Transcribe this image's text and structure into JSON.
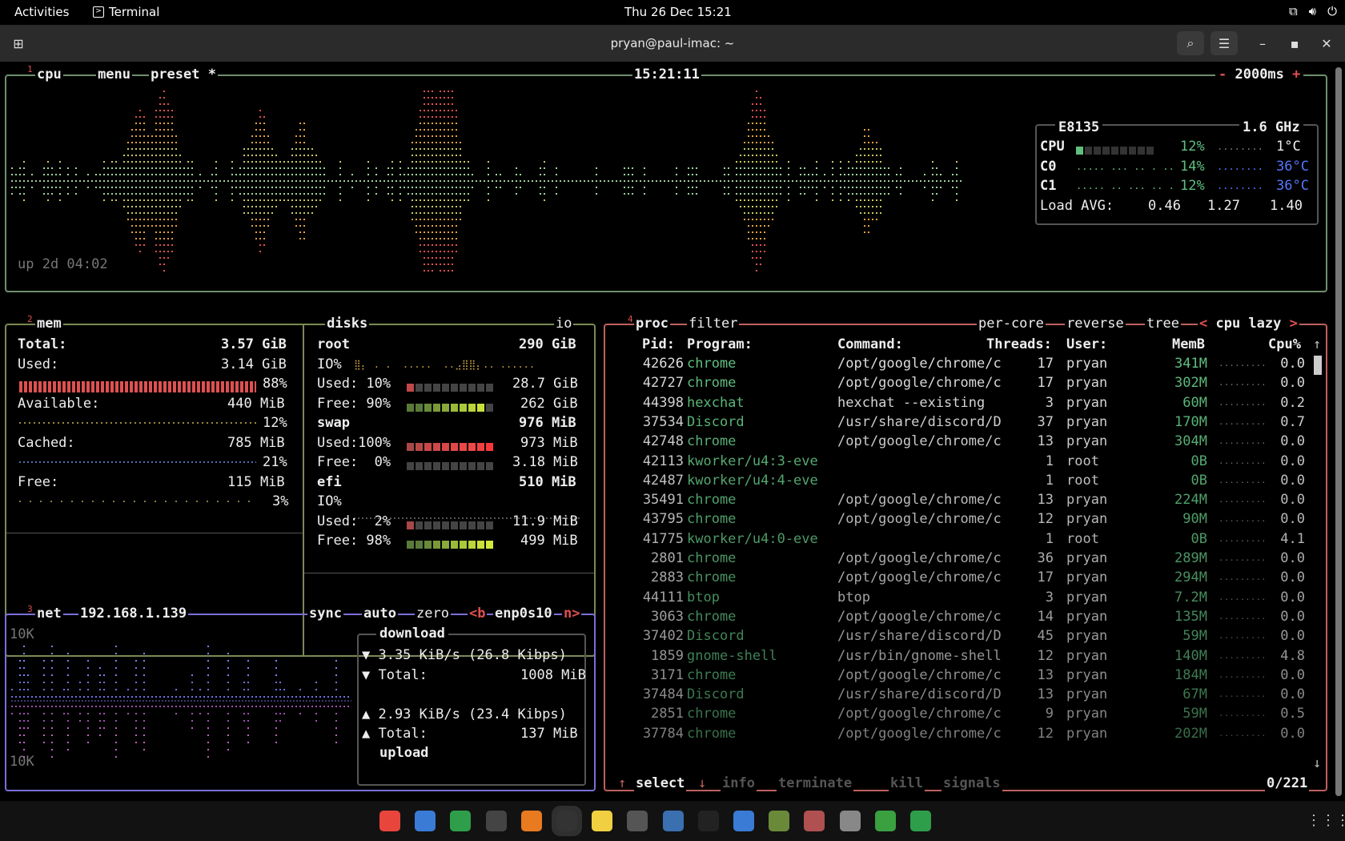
{
  "topbar": {
    "activities": "Activities",
    "app": "Terminal",
    "clock": "Thu 26 Dec  15:21",
    "tray_icons": [
      "network-icon",
      "volume-icon",
      "power-icon"
    ]
  },
  "window": {
    "title": "pryan@paul-imac: ~"
  },
  "cpu": {
    "index": "1",
    "label": "cpu",
    "menu": "menu",
    "preset": "preset *",
    "time": "15:21:11",
    "interval": "2000ms",
    "uptime": "up 2d 04:02",
    "model": "E8135",
    "freq": "1.6 GHz",
    "total_label": "CPU",
    "total_pct": "12%",
    "total_temp": "1°C",
    "core0_label": "C0",
    "core0_pct": "14%",
    "core0_temp": "36°C",
    "core1_label": "C1",
    "core1_pct": "12%",
    "core1_temp": "36°C",
    "load_label": "Load AVG:",
    "load1": "0.46",
    "load5": "1.27",
    "load15": "1.40"
  },
  "mem": {
    "index": "2",
    "label": "mem",
    "total_label": "Total:",
    "total": "3.57 GiB",
    "used_label": "Used:",
    "used": "3.14 GiB",
    "used_pct": "88%",
    "avail_label": "Available:",
    "avail": "440 MiB",
    "avail_pct": "12%",
    "cached_label": "Cached:",
    "cached": "785 MiB",
    "cached_pct": "21%",
    "free_label": "Free:",
    "free": "115 MiB",
    "free_pct": "3%"
  },
  "disks": {
    "label": "disks",
    "io": "io",
    "root_name": "root",
    "root_size": "290 GiB",
    "root_io": "IO%",
    "root_used": "Used: 10%",
    "root_used_val": "28.7 GiB",
    "root_free": "Free: 90%",
    "root_free_val": "262 GiB",
    "swap_name": "swap",
    "swap_size": "976 MiB",
    "swap_used": "Used:100%",
    "swap_used_val": "973 MiB",
    "swap_free": "Free:  0%",
    "swap_free_val": "3.18 MiB",
    "efi_name": "efi",
    "efi_size": "510 MiB",
    "efi_io": "IO%",
    "efi_used": "Used:  2%",
    "efi_used_val": "11.9 MiB",
    "efi_free": "Free: 98%",
    "efi_free_val": "499 MiB"
  },
  "net": {
    "index": "3",
    "label": "net",
    "ip": "192.168.1.139",
    "sync": "sync",
    "auto": "auto",
    "zero": "zero",
    "iface_prev": "<b",
    "iface": "enp0s10",
    "iface_next": "n>",
    "scale_top": "10K",
    "scale_bottom": "10K",
    "download": "download",
    "down_rate": "▼ 3.35 KiB/s (26.8 Kibps)",
    "down_total_label": "▼ Total:",
    "down_total": "1008 MiB",
    "up_rate": "▲ 2.93 KiB/s (23.4 Kibps)",
    "up_total_label": "▲ Total:",
    "up_total": "137 MiB",
    "upload": "upload"
  },
  "proc": {
    "index": "4",
    "label": "proc",
    "filter": "filter",
    "per_core": "per-core",
    "reverse": "reverse",
    "tree": "tree",
    "sort": "cpu lazy",
    "headers": {
      "pid": "Pid:",
      "program": "Program:",
      "command": "Command:",
      "threads": "Threads:",
      "user": "User:",
      "mem": "MemB",
      "cpu": "Cpu%"
    },
    "rows": [
      {
        "pid": "42626",
        "program": "chrome",
        "command": "/opt/google/chrome/c",
        "threads": "17",
        "user": "pryan",
        "mem": "341M",
        "cpu": "0.0"
      },
      {
        "pid": "42727",
        "program": "chrome",
        "command": "/opt/google/chrome/c",
        "threads": "17",
        "user": "pryan",
        "mem": "302M",
        "cpu": "0.0"
      },
      {
        "pid": "44398",
        "program": "hexchat",
        "command": "hexchat --existing",
        "threads": "3",
        "user": "pryan",
        "mem": "60M",
        "cpu": "0.2"
      },
      {
        "pid": "37534",
        "program": "Discord",
        "command": "/usr/share/discord/D",
        "threads": "37",
        "user": "pryan",
        "mem": "170M",
        "cpu": "0.7"
      },
      {
        "pid": "42748",
        "program": "chrome",
        "command": "/opt/google/chrome/c",
        "threads": "13",
        "user": "pryan",
        "mem": "304M",
        "cpu": "0.0"
      },
      {
        "pid": "42113",
        "program": "kworker/u4:3-eve",
        "command": "",
        "threads": "1",
        "user": "root",
        "mem": "0B",
        "cpu": "0.0"
      },
      {
        "pid": "42487",
        "program": "kworker/u4:4-eve",
        "command": "",
        "threads": "1",
        "user": "root",
        "mem": "0B",
        "cpu": "0.0"
      },
      {
        "pid": "35491",
        "program": "chrome",
        "command": "/opt/google/chrome/c",
        "threads": "13",
        "user": "pryan",
        "mem": "224M",
        "cpu": "0.0"
      },
      {
        "pid": "43795",
        "program": "chrome",
        "command": "/opt/google/chrome/c",
        "threads": "12",
        "user": "pryan",
        "mem": "90M",
        "cpu": "0.0"
      },
      {
        "pid": "41775",
        "program": "kworker/u4:0-eve",
        "command": "",
        "threads": "1",
        "user": "root",
        "mem": "0B",
        "cpu": "4.1"
      },
      {
        "pid": "2801",
        "program": "chrome",
        "command": "/opt/google/chrome/c",
        "threads": "36",
        "user": "pryan",
        "mem": "289M",
        "cpu": "0.0"
      },
      {
        "pid": "2883",
        "program": "chrome",
        "command": "/opt/google/chrome/c",
        "threads": "17",
        "user": "pryan",
        "mem": "294M",
        "cpu": "0.0"
      },
      {
        "pid": "44111",
        "program": "btop",
        "command": "btop",
        "threads": "3",
        "user": "pryan",
        "mem": "7.2M",
        "cpu": "0.0"
      },
      {
        "pid": "3063",
        "program": "chrome",
        "command": "/opt/google/chrome/c",
        "threads": "14",
        "user": "pryan",
        "mem": "135M",
        "cpu": "0.0"
      },
      {
        "pid": "37402",
        "program": "Discord",
        "command": "/usr/share/discord/D",
        "threads": "45",
        "user": "pryan",
        "mem": "59M",
        "cpu": "0.0"
      },
      {
        "pid": "1859",
        "program": "gnome-shell",
        "command": "/usr/bin/gnome-shell",
        "threads": "12",
        "user": "pryan",
        "mem": "140M",
        "cpu": "4.8"
      },
      {
        "pid": "3171",
        "program": "chrome",
        "command": "/opt/google/chrome/c",
        "threads": "13",
        "user": "pryan",
        "mem": "184M",
        "cpu": "0.0"
      },
      {
        "pid": "37484",
        "program": "Discord",
        "command": "/usr/share/discord/D",
        "threads": "13",
        "user": "pryan",
        "mem": "67M",
        "cpu": "0.0"
      },
      {
        "pid": "2851",
        "program": "chrome",
        "command": "/opt/google/chrome/c",
        "threads": "9",
        "user": "pryan",
        "mem": "59M",
        "cpu": "0.5"
      },
      {
        "pid": "37784",
        "program": "chrome",
        "command": "/opt/google/chrome/c",
        "threads": "12",
        "user": "pryan",
        "mem": "202M",
        "cpu": "0.0"
      }
    ],
    "footer_select": "select",
    "footer_info": "info",
    "footer_terminate": "terminate",
    "footer_kill": "kill",
    "footer_signals": "signals",
    "count": "0/221"
  },
  "dock": {
    "icons": [
      "chrome-icon",
      "text-editor-icon",
      "spreadsheet-icon",
      "gnome-icon",
      "vlc-icon",
      "terminal-icon",
      "notes-icon",
      "calculator-icon",
      "python-icon",
      "blackjack-icon",
      "document-icon",
      "boxes-icon",
      "software-icon",
      "settings-icon",
      "extensions-icon",
      "trash-icon"
    ]
  },
  "colors": {
    "cpu_border": "#6f8f6f",
    "mem_border": "#7a8a55",
    "net_border": "#7b6fd8",
    "proc_border": "#c06060",
    "accent_red": "#e05050"
  }
}
